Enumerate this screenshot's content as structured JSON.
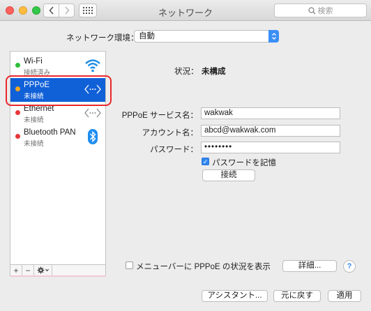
{
  "window": {
    "title": "ネットワーク",
    "search_placeholder": "検索"
  },
  "location": {
    "label": "ネットワーク環境：",
    "value": "自動"
  },
  "services": [
    {
      "name": "Wi-Fi",
      "status": "接続済み",
      "dot_color": "#2fbf3a",
      "icon": "wifi-icon"
    },
    {
      "name": "PPPoE",
      "status": "未接続",
      "dot_color": "#f5a623",
      "icon": "pppoe-icon"
    },
    {
      "name": "Ethernet",
      "status": "未接続",
      "dot_color": "#e8363a",
      "icon": "ethernet-icon"
    },
    {
      "name": "Bluetooth PAN",
      "status": "未接続",
      "dot_color": "#e8363a",
      "icon": "bluetooth-icon"
    }
  ],
  "sidebar_footer": {
    "add": "+",
    "remove": "−"
  },
  "detail": {
    "status_label": "状況：",
    "status_value": "未構成",
    "service_name_label": "PPPoE サービス名：",
    "service_name_value": "wakwak",
    "account_label": "アカウント名：",
    "account_value": "abcd@wakwak.com",
    "password_label": "パスワード：",
    "password_value": "••••••••",
    "remember_label": "パスワードを記憶",
    "remember_checked": true,
    "connect_button": "接続",
    "menubar_label": "メニューバーに PPPoE の状況を表示",
    "menubar_checked": false,
    "advanced_button": "詳細...",
    "help_button": "?"
  },
  "footer": {
    "assistant_button": "アシスタント...",
    "revert_button": "元に戻す",
    "apply_button": "適用"
  },
  "colors": {
    "selection": "#1060d8",
    "highlight": "#e8282d",
    "accent": "#2f87f2"
  }
}
